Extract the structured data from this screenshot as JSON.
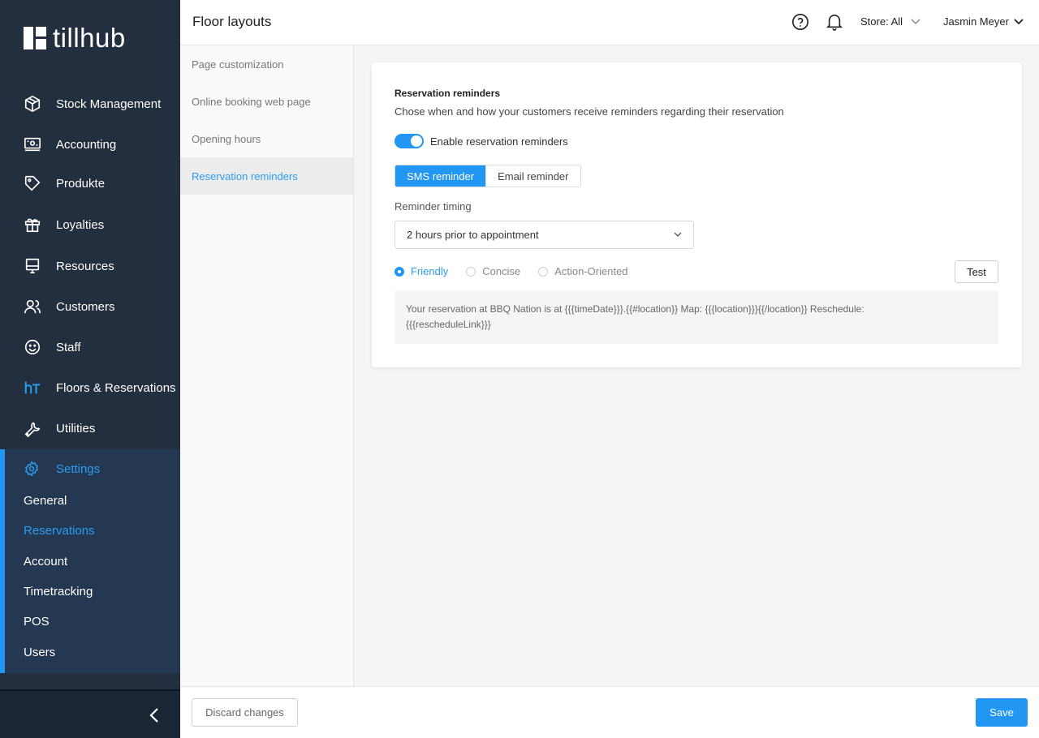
{
  "brand": {
    "name": "tillhub"
  },
  "sidebar": {
    "items": [
      {
        "label": "Stock Management",
        "icon": "box-icon"
      },
      {
        "label": "Accounting",
        "icon": "cash-register-icon"
      },
      {
        "label": "Produkte",
        "icon": "tag-icon"
      },
      {
        "label": "Loyalties",
        "icon": "gift-icon"
      },
      {
        "label": "Resources",
        "icon": "monitor-icon"
      },
      {
        "label": "Customers",
        "icon": "users-icon"
      },
      {
        "label": "Staff",
        "icon": "smiley-icon"
      },
      {
        "label": "Floors & Reservations",
        "icon": "floors-logo-icon"
      },
      {
        "label": "Utilities",
        "icon": "wrench-icon"
      }
    ],
    "settings": {
      "label": "Settings",
      "icon": "gear-icon",
      "children": [
        "General",
        "Reservations",
        "Account",
        "Timetracking",
        "POS",
        "Users"
      ],
      "active_child": "Reservations"
    }
  },
  "header": {
    "title": "Floor layouts",
    "store": "Store: All",
    "user": "Jasmin Meyer"
  },
  "subnav": {
    "items": [
      "Page customization",
      "Online booking web page",
      "Opening hours",
      "Reservation reminders"
    ],
    "active": "Reservation reminders"
  },
  "card": {
    "title": "Reservation reminders",
    "description": "Chose when and how your customers receive reminders regarding their reservation",
    "toggle_label": "Enable reservation reminders",
    "toggle_on": true,
    "tabs": [
      "SMS reminder",
      "Email reminder"
    ],
    "active_tab": "SMS reminder",
    "timing_label": "Reminder timing",
    "timing_value": "2 hours prior to appointment",
    "tones": [
      "Friendly",
      "Concise",
      "Action-Oriented"
    ],
    "selected_tone": "Friendly",
    "test_label": "Test",
    "message_line1": "Your reservation at BBQ Nation is at {{{timeDate}}}.{{#location}} Map: {{{location}}}{{/location}} Reschedule:",
    "message_line2": "{{{rescheduleLink}}}"
  },
  "footer": {
    "discard_label": "Discard changes",
    "save_label": "Save"
  },
  "colors": {
    "sidebar_bg": "#232f3e",
    "accent": "#2196f3",
    "settings_bg": "#243852"
  }
}
